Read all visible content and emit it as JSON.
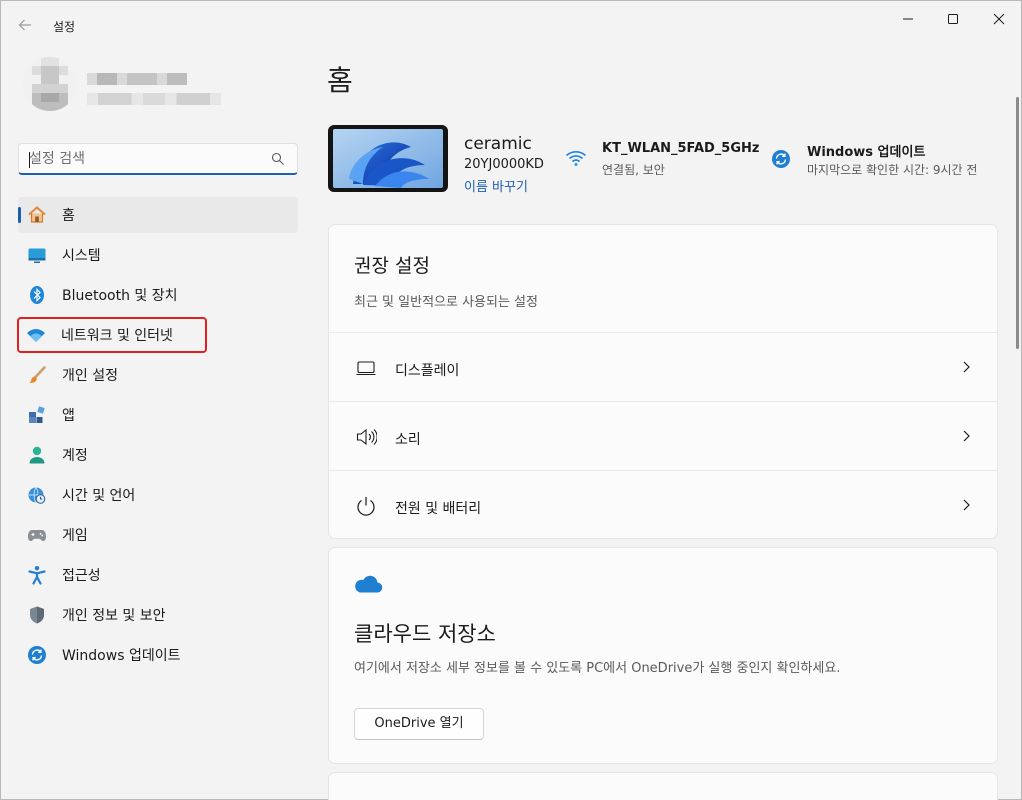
{
  "window": {
    "app_title": "설정"
  },
  "sidebar": {
    "search": {
      "placeholder": "설정 검색",
      "value": ""
    },
    "items": [
      {
        "label": "홈",
        "icon": "home-icon"
      },
      {
        "label": "시스템",
        "icon": "system-icon"
      },
      {
        "label": "Bluetooth 및 장치",
        "icon": "bluetooth-icon"
      },
      {
        "label": "네트워크 및 인터넷",
        "icon": "wifi-network-icon"
      },
      {
        "label": "개인 설정",
        "icon": "paintbrush-icon"
      },
      {
        "label": "앱",
        "icon": "apps-icon"
      },
      {
        "label": "계정",
        "icon": "account-icon"
      },
      {
        "label": "시간 및 언어",
        "icon": "time-language-icon"
      },
      {
        "label": "게임",
        "icon": "gamepad-icon"
      },
      {
        "label": "접근성",
        "icon": "accessibility-icon"
      },
      {
        "label": "개인 정보 및 보안",
        "icon": "shield-icon"
      },
      {
        "label": "Windows 업데이트",
        "icon": "windows-update-icon"
      }
    ],
    "selected_index": 0,
    "highlighted_index": 3
  },
  "main": {
    "title": "홈",
    "device": {
      "name": "ceramic",
      "model": "20YJ0000KD",
      "rename_link": "이름 바꾸기"
    },
    "network": {
      "name": "KT_WLAN_5FAD_5GHz",
      "status": "연결됨, 보안"
    },
    "update": {
      "name": "Windows 업데이트",
      "status": "마지막으로 확인한 시간: 9시간 전"
    },
    "recommended": {
      "title": "권장 설정",
      "description": "최근 및 일반적으로 사용되는 설정",
      "rows": [
        {
          "label": "디스플레이",
          "icon": "display-icon"
        },
        {
          "label": "소리",
          "icon": "speaker-icon"
        },
        {
          "label": "전원 및 배터리",
          "icon": "power-icon"
        }
      ]
    },
    "cloud": {
      "title": "클라우드 저장소",
      "description": "여기에서 저장소 세부 정보를 볼 수 있도록 PC에서 OneDrive가 실행 중인지 확인하세요.",
      "button": "OneDrive 열기"
    }
  },
  "colors": {
    "accent": "#1f5fb0",
    "highlight_box": "#e02020",
    "background": "#f3f3f3",
    "card": "#fbfbfb"
  }
}
